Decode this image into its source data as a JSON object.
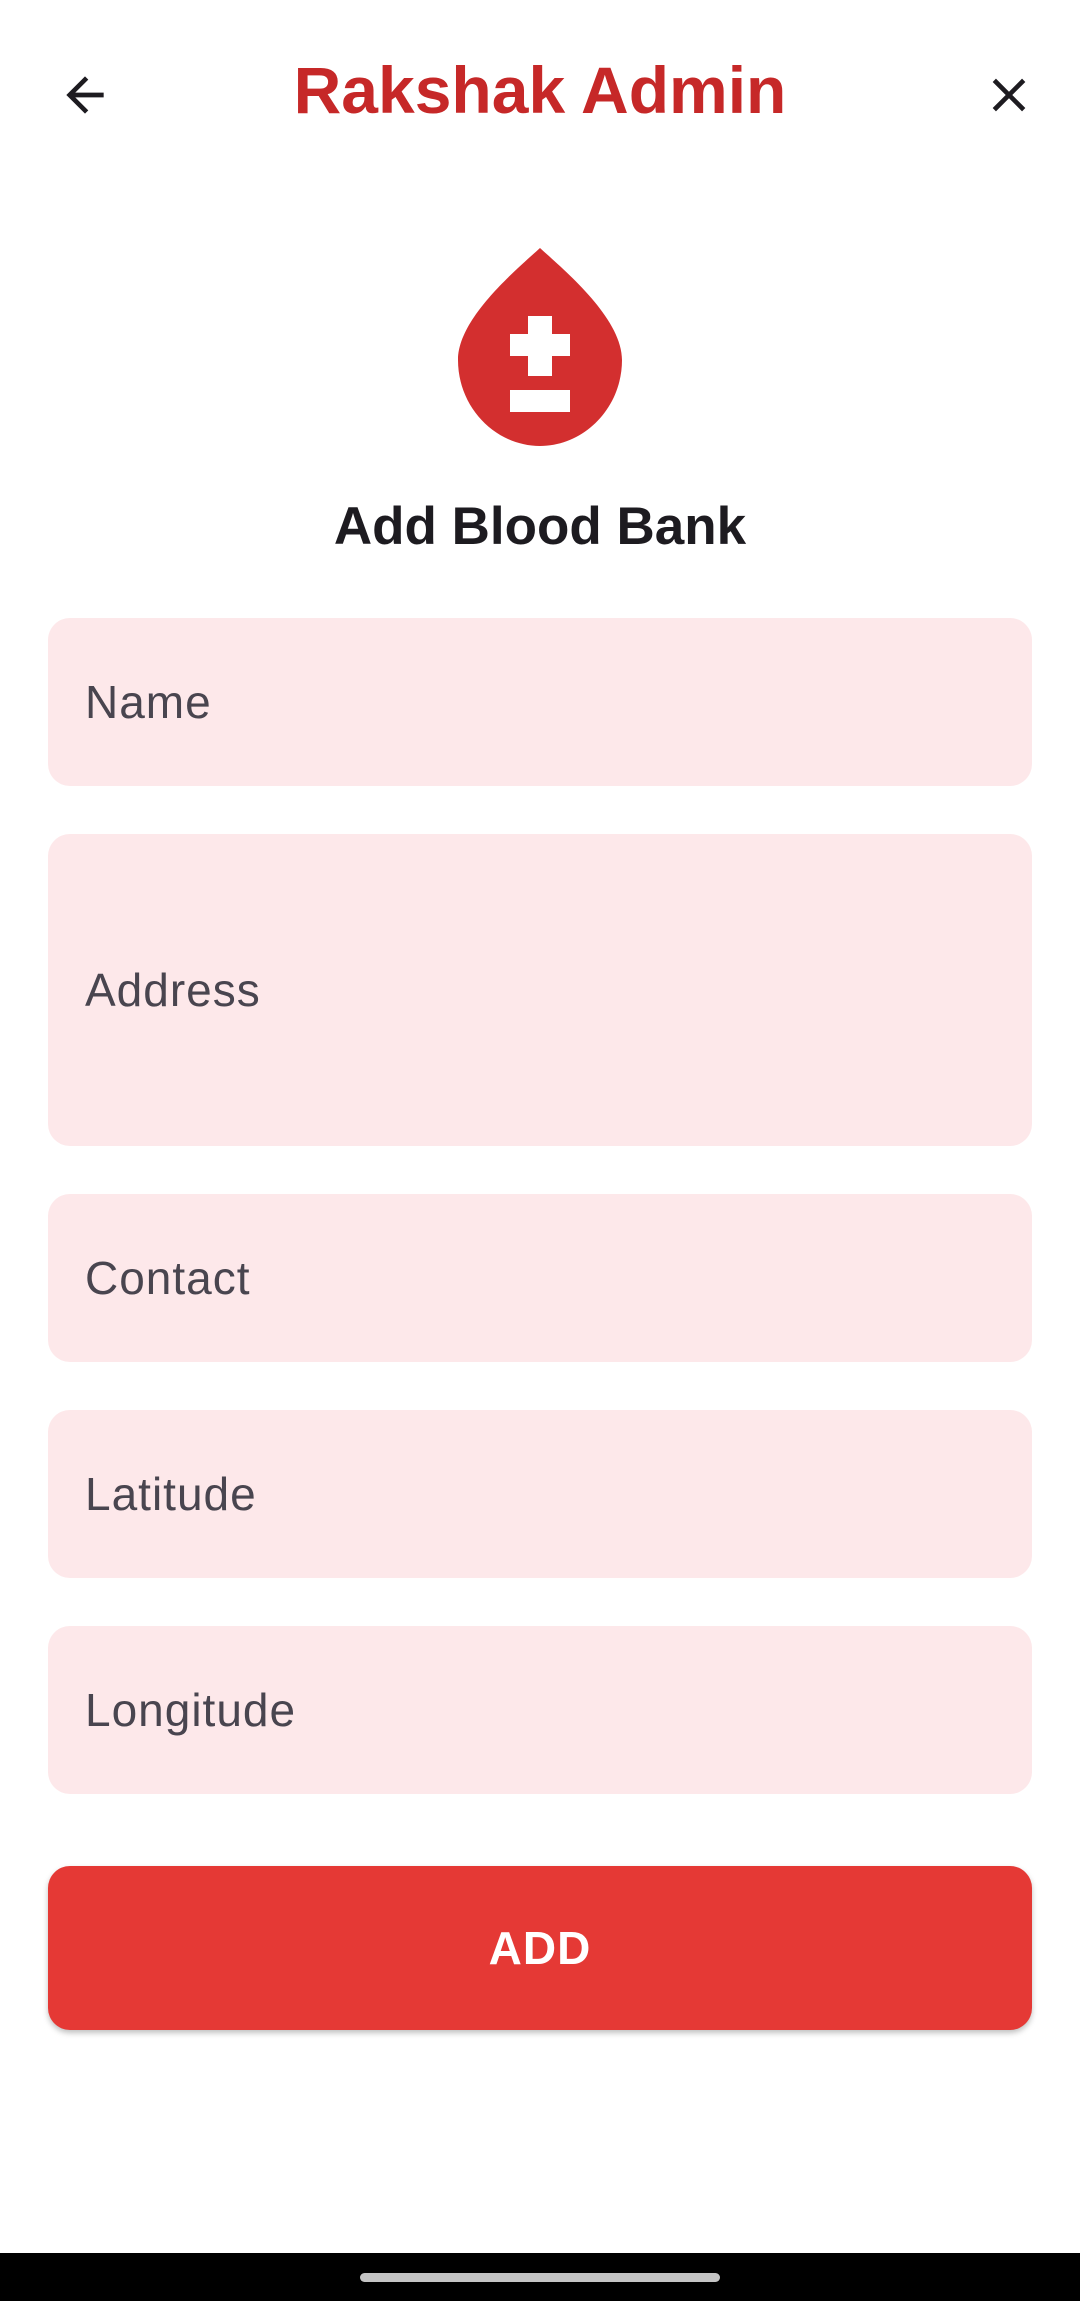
{
  "app_bar": {
    "title": "Rakshak Admin",
    "back_icon": "arrow-back-icon",
    "close_icon": "close-icon"
  },
  "logo": {
    "icon": "blood-drop-plus-minus-icon",
    "color": "#d32f2f"
  },
  "heading": "Add Blood Bank",
  "form": {
    "name": {
      "label": "Name",
      "value": ""
    },
    "address": {
      "label": "Address",
      "value": ""
    },
    "contact": {
      "label": "Contact",
      "value": ""
    },
    "latitude": {
      "label": "Latitude",
      "value": ""
    },
    "longitude": {
      "label": "Longitude",
      "value": ""
    }
  },
  "submit_label": "ADD",
  "colors": {
    "accent": "#c62828",
    "field_bg": "#fde8ea",
    "button_bg": "#e53935"
  }
}
